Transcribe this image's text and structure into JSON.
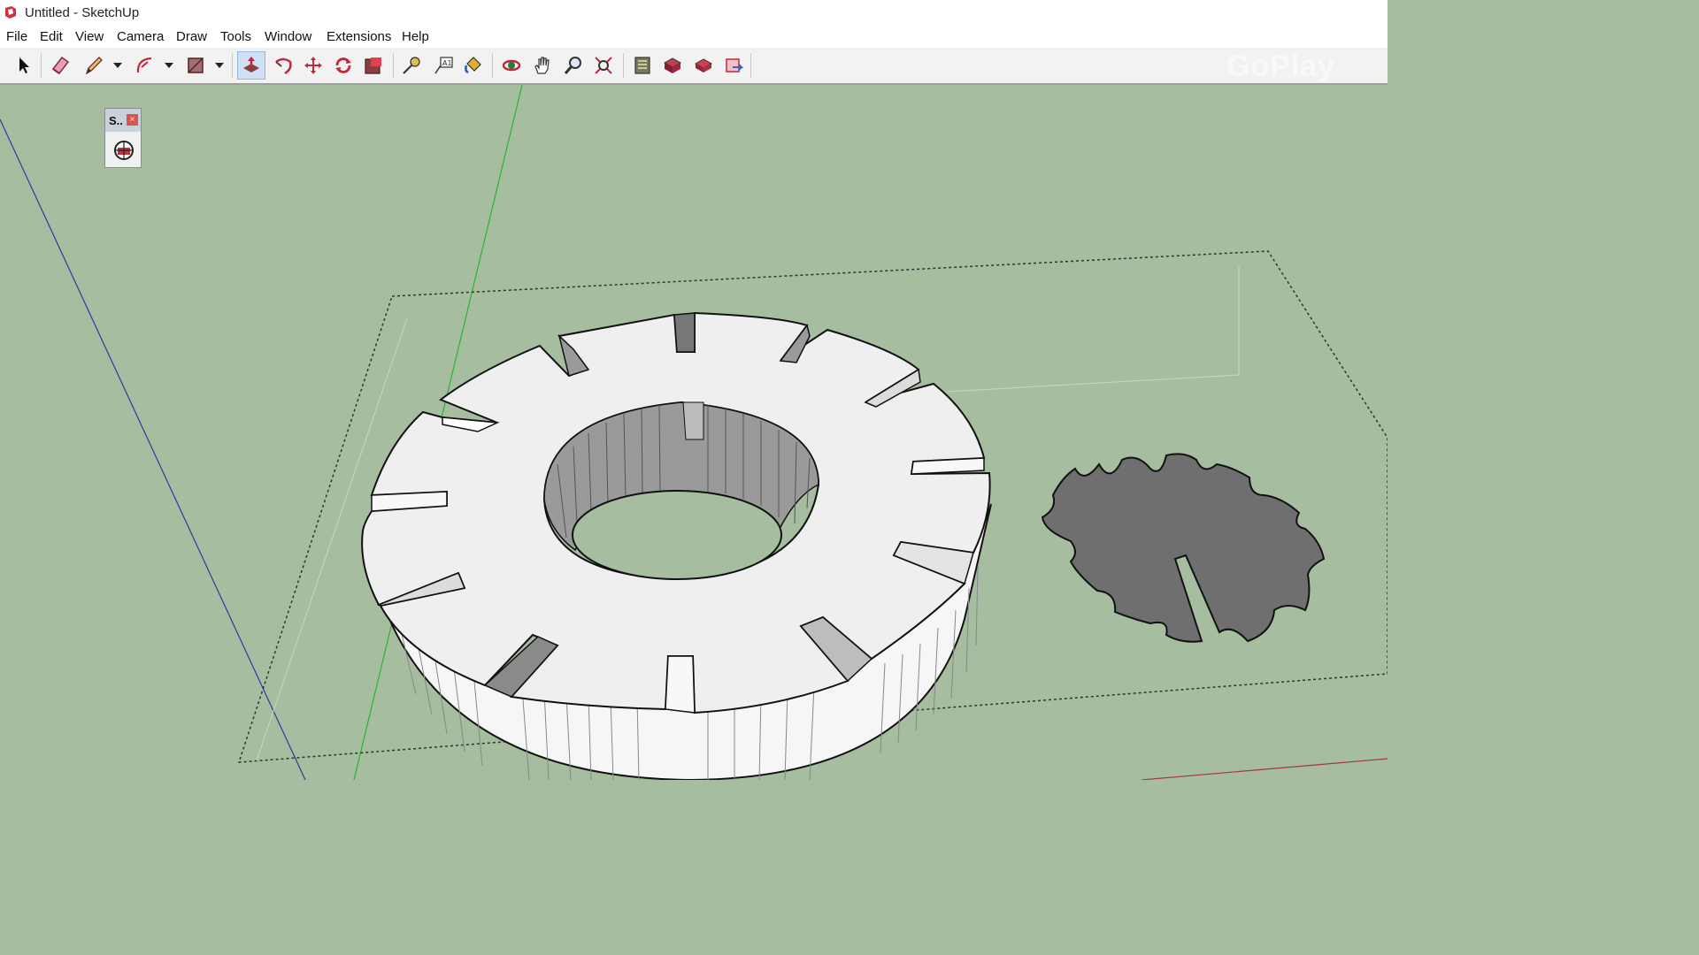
{
  "window": {
    "title": "Untitled - SketchUp",
    "icon": "sketchup-logo-icon"
  },
  "menu": [
    "File",
    "Edit",
    "View",
    "Camera",
    "Draw",
    "Tools",
    "Window",
    "Extensions",
    "Help"
  ],
  "toolbar": {
    "tools": [
      {
        "name": "select-tool",
        "icon": "arrow-cursor-icon"
      },
      {
        "name": "eraser-tool",
        "icon": "eraser-icon"
      },
      {
        "name": "line-tool",
        "icon": "pencil-icon"
      },
      {
        "name": "arc-tool",
        "icon": "arc-icon"
      },
      {
        "name": "shape-tool",
        "icon": "rectangle-icon"
      },
      {
        "name": "push-pull-tool",
        "icon": "push-pull-icon",
        "active": true
      },
      {
        "name": "follow-me-tool",
        "icon": "follow-me-icon"
      },
      {
        "name": "move-tool",
        "icon": "move-icon"
      },
      {
        "name": "rotate-tool",
        "icon": "rotate-icon"
      },
      {
        "name": "scale-tool",
        "icon": "scale-icon"
      },
      {
        "name": "tape-measure-tool",
        "icon": "tape-measure-icon"
      },
      {
        "name": "text-tool",
        "icon": "text-icon"
      },
      {
        "name": "paint-bucket-tool",
        "icon": "paint-bucket-icon"
      },
      {
        "name": "orbit-tool",
        "icon": "orbit-icon"
      },
      {
        "name": "pan-tool",
        "icon": "hand-icon"
      },
      {
        "name": "zoom-tool",
        "icon": "magnifier-icon"
      },
      {
        "name": "zoom-extents-tool",
        "icon": "zoom-extents-icon"
      },
      {
        "name": "3d-warehouse-button",
        "icon": "warehouse-icon"
      },
      {
        "name": "extension-warehouse-button",
        "icon": "extension-warehouse-icon"
      },
      {
        "name": "layout-button",
        "icon": "layout-icon"
      },
      {
        "name": "send-to-layout-button",
        "icon": "send-icon"
      }
    ]
  },
  "floating_panel": {
    "title": "S..",
    "close_label": "×",
    "button_icon": "globe-icon"
  },
  "watermark": "GoPlay",
  "colors": {
    "background": "#a6bda0",
    "model_face": "#efefef",
    "inner_face": "#9a9a9a",
    "gear_shape": "#6f6f6f",
    "green_axis": "#2bb52b",
    "blue_axis": "#2a3aa0",
    "red_axis": "#a33a3a"
  }
}
